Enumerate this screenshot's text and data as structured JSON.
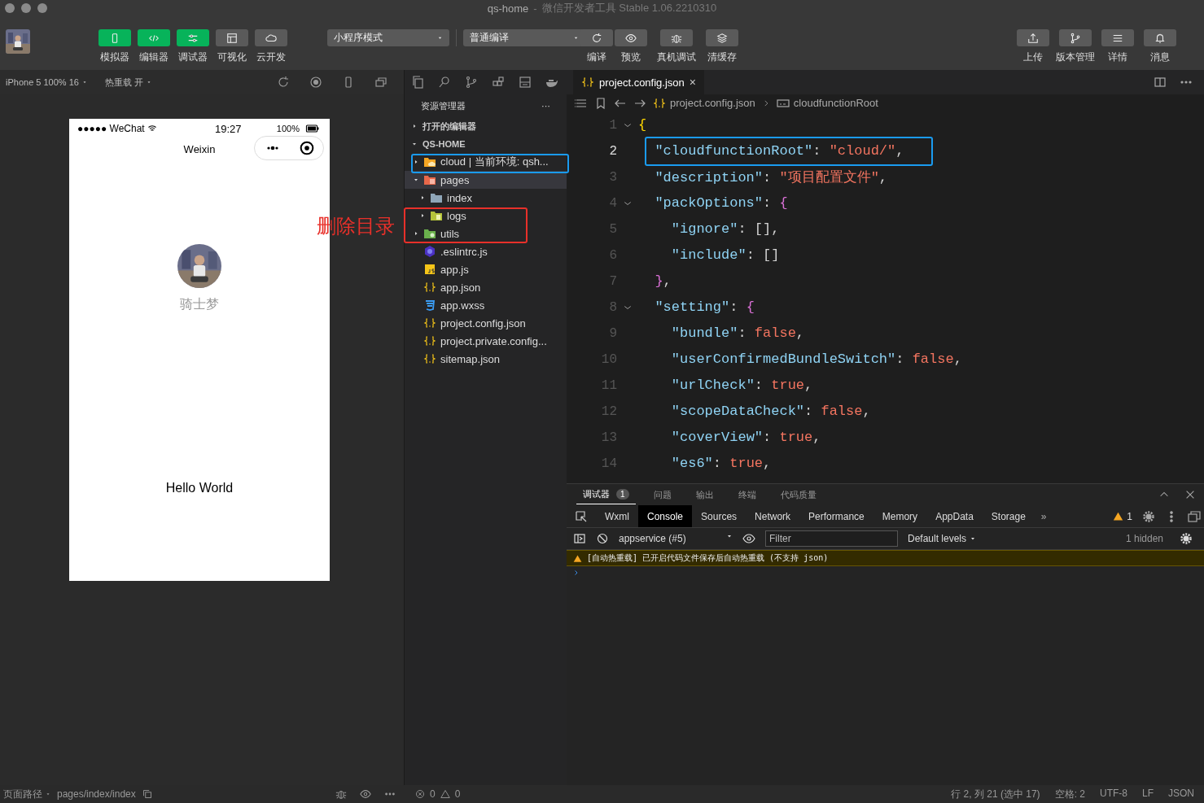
{
  "window": {
    "title": "qs-home",
    "separator": "-",
    "subtitle": "微信开发者工具 Stable 1.06.2210310"
  },
  "toolbar": {
    "view_buttons": [
      {
        "label": "模拟器",
        "kind": "phone",
        "on": true
      },
      {
        "label": "编辑器",
        "kind": "code",
        "on": true
      },
      {
        "label": "调试器",
        "kind": "sliders",
        "on": true
      },
      {
        "label": "可视化",
        "kind": "layout",
        "on": false
      },
      {
        "label": "云开发",
        "kind": "cloud",
        "on": false
      }
    ],
    "mode_select": "小程序模式",
    "compile_select": "普通编译",
    "action_buttons": [
      {
        "label": "编译",
        "kind": "refresh"
      },
      {
        "label": "预览",
        "kind": "eye"
      },
      {
        "label": "真机调试",
        "kind": "bug"
      },
      {
        "label": "清缓存",
        "kind": "layers"
      }
    ],
    "right_buttons": [
      {
        "label": "上传",
        "kind": "upload"
      },
      {
        "label": "版本管理",
        "kind": "branch"
      },
      {
        "label": "详情",
        "kind": "list"
      },
      {
        "label": "消息",
        "kind": "bell"
      }
    ]
  },
  "simulator": {
    "device": "iPhone 5 100% 16",
    "hot_reload": "热重载 开",
    "phone": {
      "carrier": "●●●●● WeChat",
      "time": "19:27",
      "battery": "100%",
      "nav_title": "Weixin",
      "user_name": "骑士梦",
      "hello": "Hello World"
    }
  },
  "explorer": {
    "title": "资源管理器",
    "more": "···",
    "sections": [
      {
        "label": "打开的编辑器",
        "expanded": false
      },
      {
        "label": "QS-HOME",
        "expanded": true
      }
    ],
    "tree": [
      {
        "label": "cloud | 当前环境: qsh...",
        "kind": "cloud-folder",
        "expanded": false,
        "selected": false
      },
      {
        "label": "pages",
        "kind": "pages-folder",
        "expanded": true,
        "selected": true,
        "children": [
          {
            "label": "index",
            "kind": "folder",
            "expanded": false,
            "selected": false
          },
          {
            "label": "logs",
            "kind": "logs-folder",
            "expanded": false,
            "selected": false
          }
        ]
      },
      {
        "label": "utils",
        "kind": "utils-folder",
        "expanded": false,
        "selected": false
      },
      {
        "label": ".eslintrc.js",
        "kind": "eslint",
        "selected": false
      },
      {
        "label": "app.js",
        "kind": "js",
        "selected": false
      },
      {
        "label": "app.json",
        "kind": "json",
        "selected": false
      },
      {
        "label": "app.wxss",
        "kind": "css",
        "selected": false
      },
      {
        "label": "project.config.json",
        "kind": "json",
        "selected": false
      },
      {
        "label": "project.private.config...",
        "kind": "json",
        "selected": false
      },
      {
        "label": "sitemap.json",
        "kind": "json",
        "selected": false
      }
    ]
  },
  "annotation": {
    "label": "删除目录"
  },
  "editor": {
    "tab": "project.config.json",
    "tab_close": "×",
    "breadcrumb": [
      "project.config.json",
      "cloudfunctionRoot"
    ],
    "lines": [
      {
        "n": "1",
        "current": false,
        "foldable": true,
        "highlighted": false,
        "tokens": [
          {
            "kind": "brace1",
            "text": "{"
          }
        ]
      },
      {
        "n": "2",
        "current": true,
        "foldable": false,
        "highlighted": true,
        "tokens": [
          {
            "kind": "key",
            "text": "  \"cloudfunctionRoot\""
          },
          {
            "kind": "punct",
            "text": ": "
          },
          {
            "kind": "str",
            "text": "\"cloud/\""
          },
          {
            "kind": "punct",
            "text": ","
          }
        ]
      },
      {
        "n": "3",
        "current": false,
        "foldable": false,
        "highlighted": false,
        "tokens": [
          {
            "kind": "key",
            "text": "  \"description\""
          },
          {
            "kind": "punct",
            "text": ": "
          },
          {
            "kind": "str",
            "text": "\"项目配置文件\""
          },
          {
            "kind": "punct",
            "text": ","
          }
        ]
      },
      {
        "n": "4",
        "current": false,
        "foldable": true,
        "highlighted": false,
        "tokens": [
          {
            "kind": "key",
            "text": "  \"packOptions\""
          },
          {
            "kind": "punct",
            "text": ": "
          },
          {
            "kind": "brace2",
            "text": "{"
          }
        ]
      },
      {
        "n": "5",
        "current": false,
        "foldable": false,
        "highlighted": false,
        "tokens": [
          {
            "kind": "key",
            "text": "    \"ignore\""
          },
          {
            "kind": "punct",
            "text": ": [],"
          }
        ]
      },
      {
        "n": "6",
        "current": false,
        "foldable": false,
        "highlighted": false,
        "tokens": [
          {
            "kind": "key",
            "text": "    \"include\""
          },
          {
            "kind": "punct",
            "text": ": []"
          }
        ]
      },
      {
        "n": "7",
        "current": false,
        "foldable": false,
        "highlighted": false,
        "tokens": [
          {
            "kind": "brace2",
            "text": "  }"
          },
          {
            "kind": "punct",
            "text": ","
          }
        ]
      },
      {
        "n": "8",
        "current": false,
        "foldable": true,
        "highlighted": false,
        "tokens": [
          {
            "kind": "key",
            "text": "  \"setting\""
          },
          {
            "kind": "punct",
            "text": ": "
          },
          {
            "kind": "brace2",
            "text": "{"
          }
        ]
      },
      {
        "n": "9",
        "current": false,
        "foldable": false,
        "highlighted": false,
        "tokens": [
          {
            "kind": "key",
            "text": "    \"bundle\""
          },
          {
            "kind": "punct",
            "text": ": "
          },
          {
            "kind": "str",
            "text": "false"
          },
          {
            "kind": "punct",
            "text": ","
          }
        ]
      },
      {
        "n": "10",
        "current": false,
        "foldable": false,
        "highlighted": false,
        "tokens": [
          {
            "kind": "key",
            "text": "    \"userConfirmedBundleSwitch\""
          },
          {
            "kind": "punct",
            "text": ": "
          },
          {
            "kind": "str",
            "text": "false"
          },
          {
            "kind": "punct",
            "text": ","
          }
        ]
      },
      {
        "n": "11",
        "current": false,
        "foldable": false,
        "highlighted": false,
        "tokens": [
          {
            "kind": "key",
            "text": "    \"urlCheck\""
          },
          {
            "kind": "punct",
            "text": ": "
          },
          {
            "kind": "str",
            "text": "true"
          },
          {
            "kind": "punct",
            "text": ","
          }
        ]
      },
      {
        "n": "12",
        "current": false,
        "foldable": false,
        "highlighted": false,
        "tokens": [
          {
            "kind": "key",
            "text": "    \"scopeDataCheck\""
          },
          {
            "kind": "punct",
            "text": ": "
          },
          {
            "kind": "str",
            "text": "false"
          },
          {
            "kind": "punct",
            "text": ","
          }
        ]
      },
      {
        "n": "13",
        "current": false,
        "foldable": false,
        "highlighted": false,
        "tokens": [
          {
            "kind": "key",
            "text": "    \"coverView\""
          },
          {
            "kind": "punct",
            "text": ": "
          },
          {
            "kind": "str",
            "text": "true"
          },
          {
            "kind": "punct",
            "text": ","
          }
        ]
      },
      {
        "n": "14",
        "current": false,
        "foldable": false,
        "highlighted": false,
        "tokens": [
          {
            "kind": "key",
            "text": "    \"es6\""
          },
          {
            "kind": "punct",
            "text": ": "
          },
          {
            "kind": "str",
            "text": "true"
          },
          {
            "kind": "punct",
            "text": ","
          }
        ]
      }
    ]
  },
  "devtools": {
    "panel_tabs": [
      {
        "label": "调试器",
        "selected": true,
        "badge": "1"
      },
      {
        "label": "问题",
        "selected": false
      },
      {
        "label": "输出",
        "selected": false
      },
      {
        "label": "终端",
        "selected": false
      },
      {
        "label": "代码质量",
        "selected": false
      }
    ],
    "tabs": [
      {
        "label": "Wxml",
        "selected": false
      },
      {
        "label": "Console",
        "selected": true
      },
      {
        "label": "Sources",
        "selected": false
      },
      {
        "label": "Network",
        "selected": false
      },
      {
        "label": "Performance",
        "selected": false
      },
      {
        "label": "Memory",
        "selected": false
      },
      {
        "label": "AppData",
        "selected": false
      },
      {
        "label": "Storage",
        "selected": false
      }
    ],
    "more_tabs": "»",
    "warning_count": "1",
    "context": "appservice (#5)",
    "filter": {
      "placeholder": "Filter"
    },
    "levels": "Default levels",
    "hidden": "1 hidden",
    "messages": [
      {
        "kind": "warning",
        "text": "[自动热重载] 已开启代码文件保存后自动热重载 (不支持 json)"
      }
    ]
  },
  "status_bar": {
    "page_path_label": "页面路径",
    "page_path": "pages/index/index",
    "errors": "0",
    "warnings": "0",
    "right": [
      "行 2, 列 21 (选中 17)",
      "空格: 2",
      "UTF-8",
      "LF",
      "JSON"
    ]
  }
}
